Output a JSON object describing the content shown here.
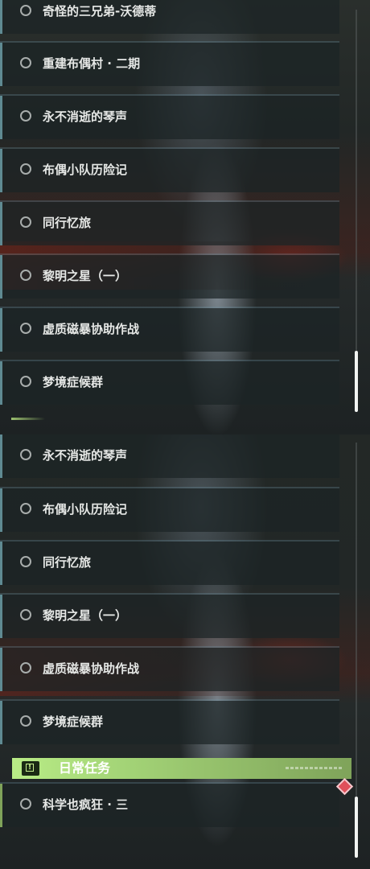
{
  "top_panel": {
    "items": [
      {
        "label": "奇怪的三兄弟-沃德蒂"
      },
      {
        "label": "重建布偶村 · 二期"
      },
      {
        "label": "永不消逝的琴声"
      },
      {
        "label": "布偶小队历险记"
      },
      {
        "label": "同行忆旅"
      },
      {
        "label": "黎明之星（一）"
      },
      {
        "label": "虚质磁暴协助作战"
      },
      {
        "label": "梦境症候群"
      }
    ]
  },
  "bottom_panel": {
    "items": [
      {
        "label": "永不消逝的琴声"
      },
      {
        "label": "布偶小队历险记"
      },
      {
        "label": "同行忆旅"
      },
      {
        "label": "黎明之星（一）"
      },
      {
        "label": "虚质磁暴协助作战"
      },
      {
        "label": "梦境症候群"
      }
    ],
    "daily_section": {
      "title": "日常任务",
      "icon": "alert-icon",
      "items": [
        {
          "label": "科学也疯狂 · 三"
        }
      ]
    }
  },
  "colors": {
    "item_accent": "#5f8a92",
    "daily_accent": "#a5d678",
    "notification": "#e0505a"
  }
}
